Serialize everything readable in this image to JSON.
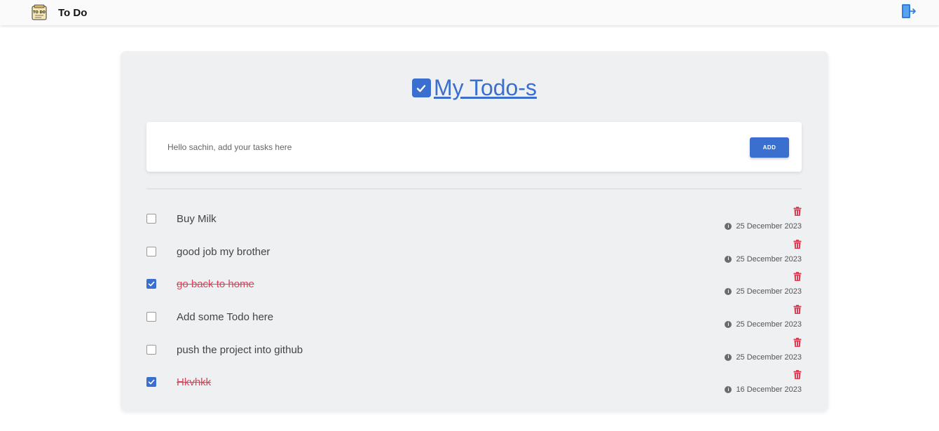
{
  "navbar": {
    "title": "To Do",
    "logo_text": "TO DO"
  },
  "heading": {
    "title": "My Todo-s"
  },
  "input": {
    "placeholder": "Hello sachin, add your tasks here",
    "value": "",
    "add_label": "ADD"
  },
  "colors": {
    "accent": "#3a6fd0",
    "danger": "#d9435a",
    "card_bg": "#eff0f2"
  },
  "todos": [
    {
      "text": "Buy Milk",
      "done": false,
      "date": "25 December 2023"
    },
    {
      "text": "good job my brother",
      "done": false,
      "date": "25 December 2023"
    },
    {
      "text": "go back to home",
      "done": true,
      "date": "25 December 2023"
    },
    {
      "text": "Add some Todo here",
      "done": false,
      "date": "25 December 2023"
    },
    {
      "text": "push the project into github",
      "done": false,
      "date": "25 December 2023"
    },
    {
      "text": "Hkvhkk",
      "done": true,
      "date": "16 December 2023"
    }
  ],
  "icons": {
    "logo": "todo-note-icon",
    "logout": "logout-door-icon",
    "heading": "checkbox-checked-icon",
    "delete": "trash-icon",
    "info": "info-icon"
  }
}
